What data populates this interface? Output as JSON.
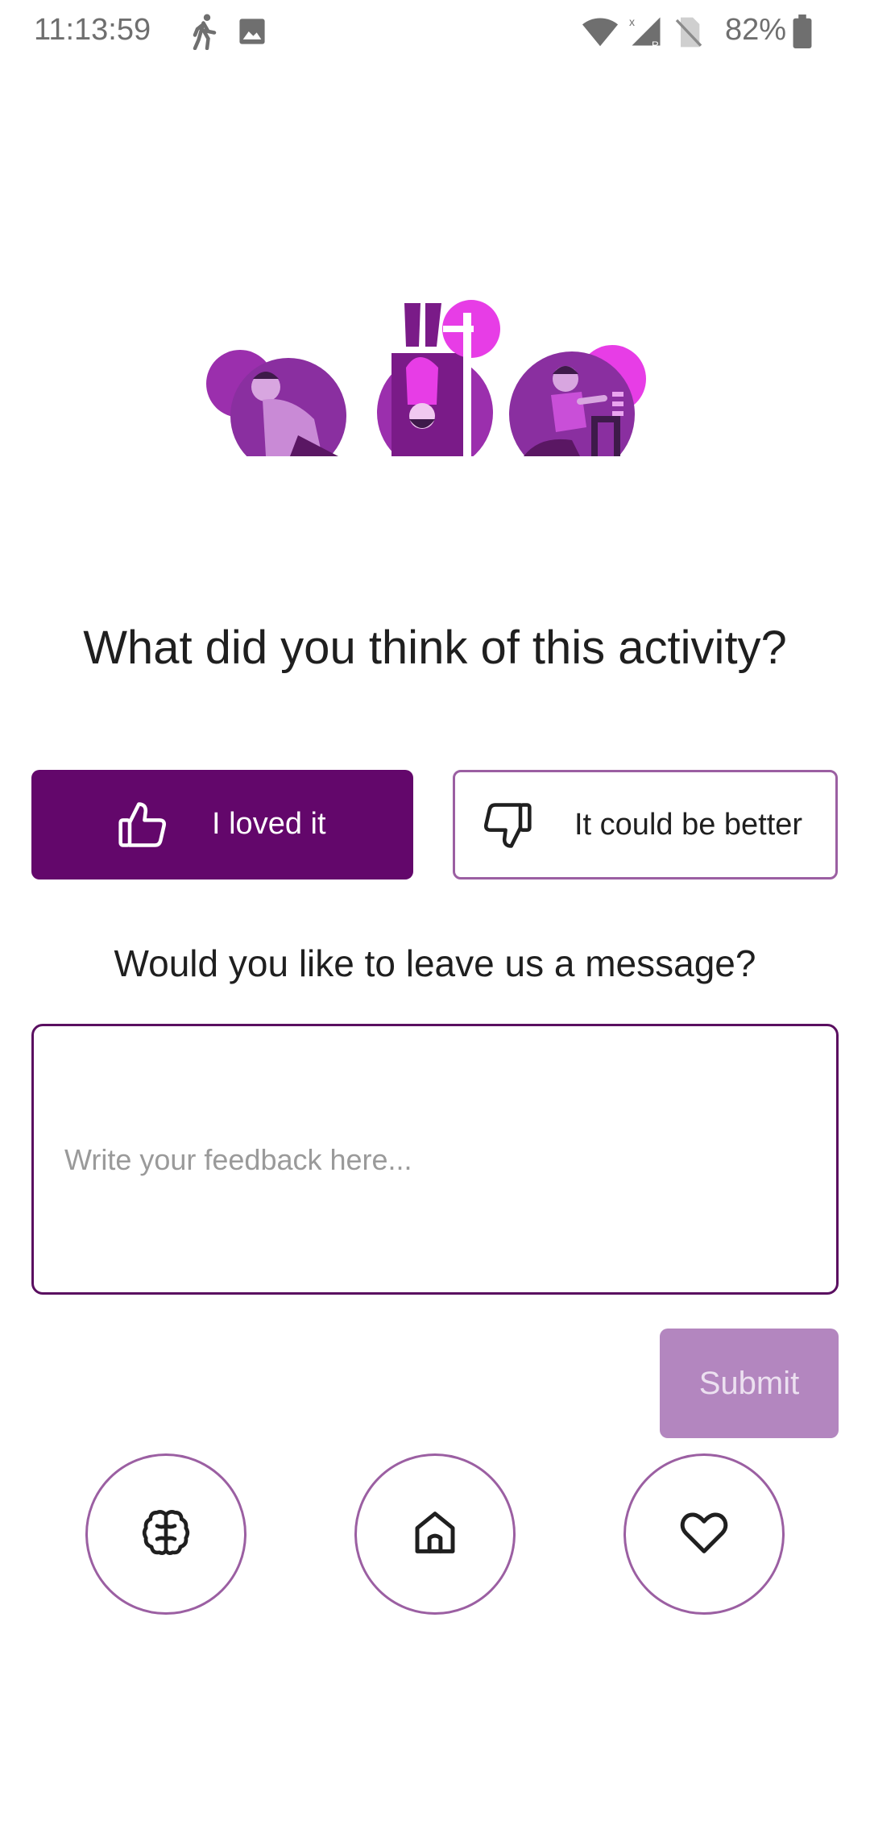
{
  "status_bar": {
    "time": "11:13:59",
    "battery": "82%",
    "icons": [
      "walking-icon",
      "image-icon",
      "wifi-icon",
      "signal-icon",
      "no-sim-icon",
      "battery-icon"
    ]
  },
  "feedback": {
    "question": "What did you think of this activity?",
    "loved_label": "I loved it",
    "better_label": "It could be better",
    "message_question": "Would you like to leave us a message?",
    "placeholder": "Write your feedback here...",
    "submit_label": "Submit"
  },
  "bottom_nav": {
    "items": [
      {
        "icon": "brain-icon"
      },
      {
        "icon": "home-icon"
      },
      {
        "icon": "heart-icon"
      }
    ]
  },
  "colors": {
    "primary": "#63076b",
    "outline": "#9b5fa2",
    "submit_disabled": "#b386bf",
    "accent_pink": "#e73de6"
  }
}
